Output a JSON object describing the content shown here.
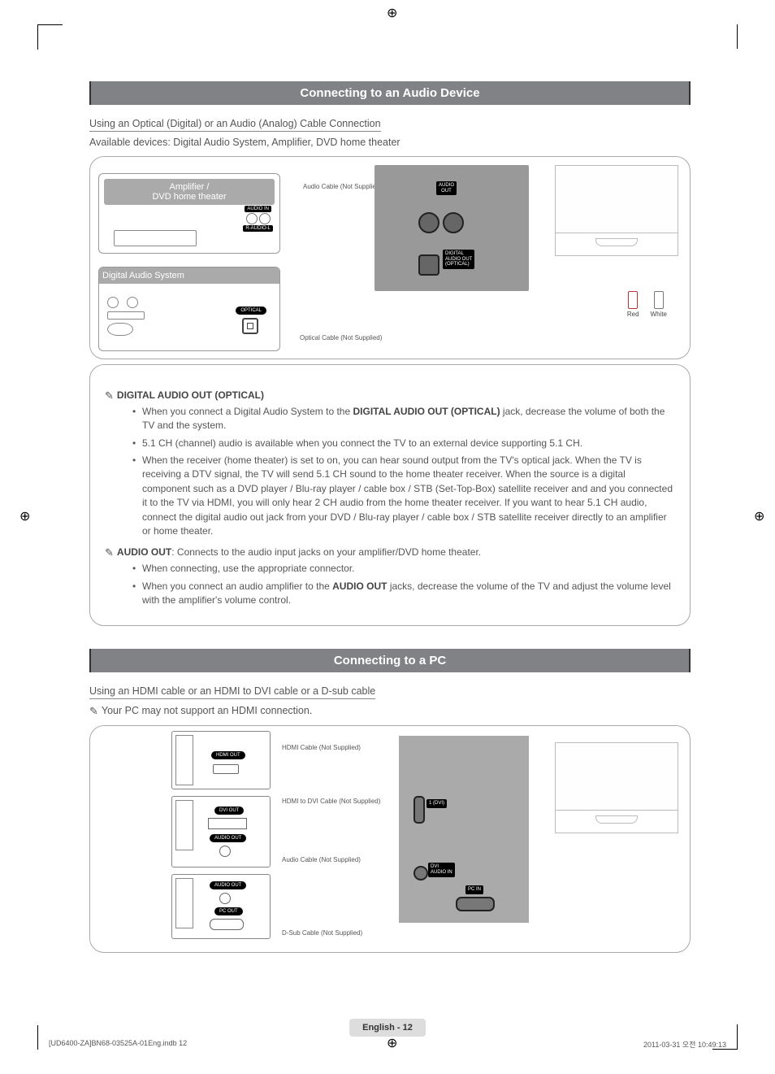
{
  "registration_mark": "⊕",
  "section1": {
    "title": "Connecting to an Audio Device",
    "subhead": "Using an Optical (Digital) or an Audio (Analog) Cable Connection",
    "available": "Available devices: Digital Audio System, Amplifier, DVD home theater",
    "diag": {
      "amp_title": "Amplifier /\nDVD home theater",
      "audio_in": "AUDIO IN",
      "r_audio_l": "R-AUDIO-L",
      "audio_cable": "Audio Cable (Not Supplied)",
      "das_title": "Digital Audio System",
      "optical": "OPTICAL",
      "optical_cable": "Optical Cable (Not Supplied)",
      "tv_audio_out": "AUDIO\nOUT",
      "tv_digital_out": "DIGITAL\nAUDIO OUT\n(OPTICAL)",
      "plug_red": "Red",
      "plug_white": "White"
    },
    "notes": {
      "h1": "DIGITAL AUDIO OUT (OPTICAL)",
      "b1": "When you connect a Digital Audio System to the DIGITAL AUDIO OUT (OPTICAL) jack, decrease the volume of both the TV and the system.",
      "b1_bold": "DIGITAL AUDIO OUT (OPTICAL)",
      "b2": "5.1 CH (channel) audio is available when you connect the TV to an external device supporting 5.1 CH.",
      "b3": "When the receiver (home theater) is set to on, you can hear sound output from the TV's optical jack. When the TV is receiving a DTV signal, the TV will send 5.1 CH sound to the home theater receiver. When the source is a digital component such as a DVD player / Blu-ray player / cable box / STB (Set-Top-Box) satellite receiver and and you connected it to the TV via HDMI, you will only hear 2 CH audio from the home theater receiver. If you want to hear 5.1 CH audio, connect the digital audio out jack from your DVD / Blu-ray player / cable box / STB satellite receiver directly to an amplifier or home theater.",
      "h2_pre": "AUDIO OUT",
      "h2": ": Connects to the audio input jacks on your amplifier/DVD home theater.",
      "b4": "When connecting, use the appropriate connector.",
      "b5_pre": "When you connect an audio amplifier to the ",
      "b5_bold": "AUDIO OUT",
      "b5_post": " jacks, decrease the volume of the TV and adjust the volume level with the amplifier's volume control."
    }
  },
  "section2": {
    "title": "Connecting to a PC",
    "subhead": "Using an HDMI cable or an HDMI to DVI cable or a D-sub cable",
    "note": "Your PC may not support an HDMI connection.",
    "diag": {
      "hdmi_out": "HDMI OUT",
      "dvi_out": "DVI OUT",
      "audio_out": "AUDIO OUT",
      "pc_out": "PC OUT",
      "hdmi_cable": "HDMI Cable (Not Supplied)",
      "hdmi_dvi_cable": "HDMI to DVI Cable (Not Supplied)",
      "audio_cable": "Audio Cable (Not Supplied)",
      "dsub_cable": "D-Sub Cable (Not Supplied)",
      "tv_dvi_audio": "DVI\nAUDIO IN",
      "tv_pc_in": "PC IN"
    }
  },
  "footer": {
    "page": "English - 12",
    "left": "[UD6400-ZA]BN68-03525A-01Eng.indb   12",
    "right": "2011-03-31   오전 10:49:13"
  }
}
